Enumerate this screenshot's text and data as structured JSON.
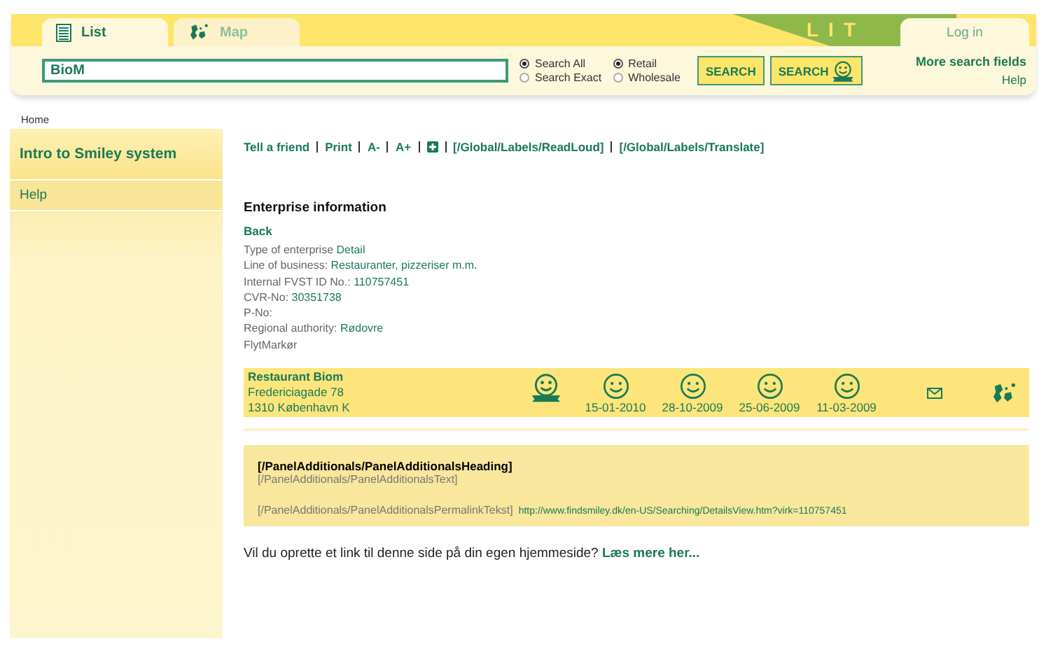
{
  "header": {
    "tabs": [
      {
        "label": "List",
        "kind": "list",
        "selected": true
      },
      {
        "label": "Map",
        "kind": "map",
        "selected": false
      }
    ],
    "banner_text": "LIT",
    "login": "Log in"
  },
  "search": {
    "value": "BioM",
    "scope": [
      {
        "label": "Search All",
        "selected": true
      },
      {
        "label": "Search Exact",
        "selected": false
      }
    ],
    "type": [
      {
        "label": "Retail",
        "selected": true
      },
      {
        "label": "Wholesale",
        "selected": false
      }
    ],
    "buttons": [
      {
        "label": "SEARCH",
        "kind": "plain"
      },
      {
        "label": "SEARCH",
        "kind": "smiley"
      }
    ],
    "more": "More search fields",
    "help": "Help"
  },
  "breadcrumb": "Home",
  "sidebar": {
    "items": [
      {
        "label": "Intro to Smiley system",
        "kind": "heading"
      },
      {
        "label": "Help",
        "kind": "item"
      }
    ]
  },
  "toolbar": [
    {
      "kind": "text",
      "label": "Tell a friend"
    },
    {
      "kind": "text",
      "label": "Print"
    },
    {
      "kind": "text",
      "label": "A-"
    },
    {
      "kind": "text",
      "label": "A+"
    },
    {
      "kind": "icon"
    },
    {
      "kind": "text",
      "label": "[/Global/Labels/ReadLoud]"
    },
    {
      "kind": "text",
      "label": "[/Global/Labels/Translate]"
    }
  ],
  "enterprise": {
    "heading": "Enterprise information",
    "back": "Back",
    "fields": [
      {
        "label": "Type of enterprise",
        "value": "Detail"
      },
      {
        "label": "Line of business:",
        "value": "Restauranter, pizzeriser m.m."
      },
      {
        "label": "Internal FVST ID No.:",
        "value": "110757451"
      },
      {
        "label": "CVR-No:",
        "value": "30351738"
      },
      {
        "label": "P-No:"
      },
      {
        "label": "Regional authority:",
        "value": "Rødovre"
      },
      {
        "label": "FlytMarkør"
      }
    ]
  },
  "result": {
    "name": "Restaurant Biom",
    "address": [
      "Fredericiagade 78",
      "1310 København K"
    ],
    "elite": true,
    "inspections": [
      {
        "date": "15-01-2010"
      },
      {
        "date": "28-10-2009"
      },
      {
        "date": "25-06-2009"
      },
      {
        "date": "11-03-2009"
      }
    ]
  },
  "panel": {
    "heading": "[/PanelAdditionals/PanelAdditionalsHeading]",
    "text": "[/PanelAdditionals/PanelAdditionalsText]",
    "permalink_label": "[/PanelAdditionals/PanelAdditionalsPermalinkTekst]",
    "url": "http://www.findsmiley.dk/en-US/Searching/DetailsView.htm?virk=110757451"
  },
  "footer": {
    "text": "Vil du oprette et link til denne side på din egen hjemmeside?",
    "link": "Læs mere her..."
  }
}
